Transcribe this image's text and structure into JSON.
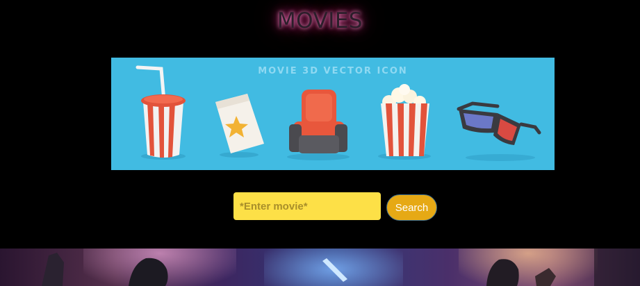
{
  "header": {
    "title": "MOVIES"
  },
  "banner": {
    "caption": "MOVIE 3D VECTOR ICON",
    "icons": [
      "soda-cup-icon",
      "ticket-icon",
      "cinema-seat-icon",
      "popcorn-icon",
      "3d-glasses-icon"
    ]
  },
  "search": {
    "placeholder": "*Enter movie*",
    "value": "",
    "button_label": "Search"
  },
  "poster": {
    "subject": "movie-poster-image"
  },
  "colors": {
    "background": "#000000",
    "banner": "#41bbe2",
    "input": "#fde047",
    "button": "#e6a915",
    "title_glow": "#e0409a"
  }
}
